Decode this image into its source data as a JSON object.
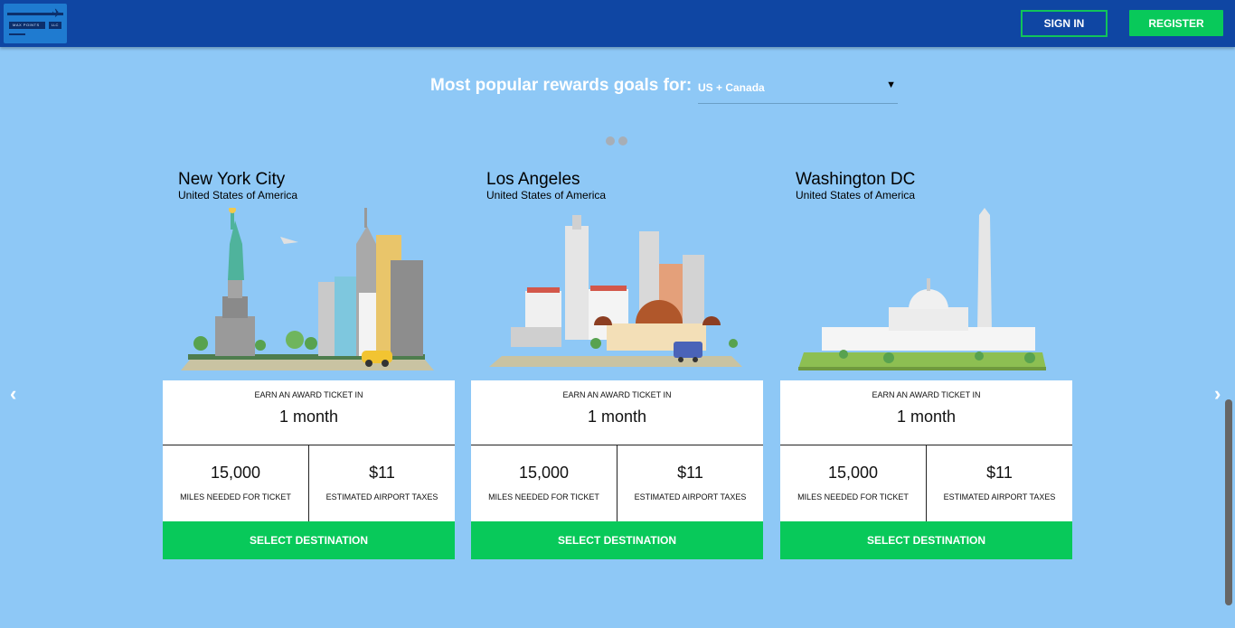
{
  "header": {
    "logo_text": "MAX POINTS",
    "logo_text2": "LLC",
    "signin_label": "SIGN IN",
    "register_label": "REGISTER"
  },
  "goals": {
    "heading": "Most popular rewards goals for:",
    "region_value": "US + Canada",
    "dropdown_icon": "caret-down-icon"
  },
  "carousel": {
    "prev_icon": "chevron-left-icon",
    "next_icon": "chevron-right-icon",
    "dots_count": 2
  },
  "cards": [
    {
      "city": "New York City",
      "country": "United States of America",
      "earn_label": "EARN AN AWARD TICKET IN",
      "duration": "1 month",
      "miles_value": "15,000",
      "miles_label": "MILES NEEDED FOR TICKET",
      "tax_value": "$11",
      "tax_label": "ESTIMATED AIRPORT TAXES",
      "select_label": "SELECT DESTINATION"
    },
    {
      "city": "Los Angeles",
      "country": "United States of America",
      "earn_label": "EARN AN AWARD TICKET IN",
      "duration": "1 month",
      "miles_value": "15,000",
      "miles_label": "MILES NEEDED FOR TICKET",
      "tax_value": "$11",
      "tax_label": "ESTIMATED AIRPORT TAXES",
      "select_label": "SELECT DESTINATION"
    },
    {
      "city": "Washington DC",
      "country": "United States of America",
      "earn_label": "EARN AN AWARD TICKET IN",
      "duration": "1 month",
      "miles_value": "15,000",
      "miles_label": "MILES NEEDED FOR TICKET",
      "tax_value": "$11",
      "tax_label": "ESTIMATED AIRPORT TAXES",
      "select_label": "SELECT DESTINATION"
    }
  ],
  "colors": {
    "background": "#8ec8f6",
    "header": "#0f46a3",
    "accent_green": "#08c95a"
  }
}
